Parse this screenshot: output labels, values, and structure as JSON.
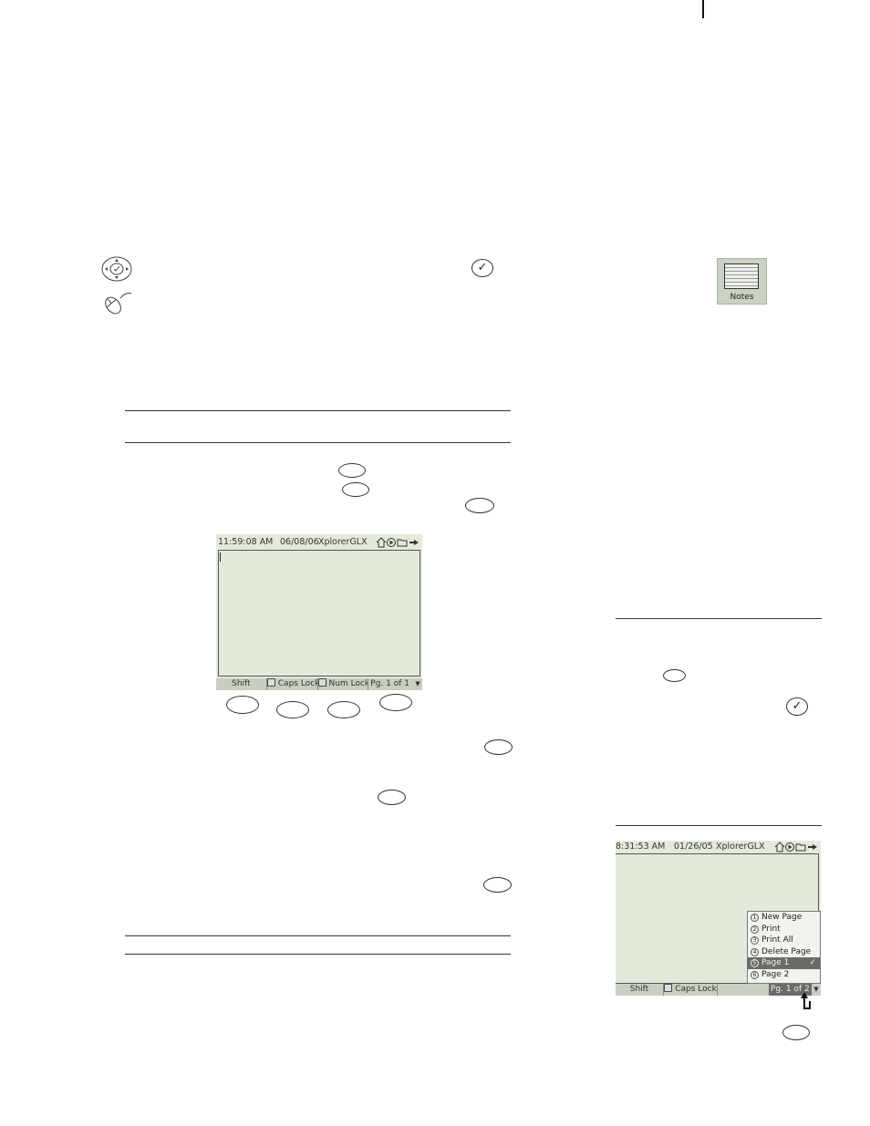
{
  "notes_icon": {
    "label": "Notes"
  },
  "check_symbol": "✓",
  "screen1": {
    "time": "11:59:08 AM",
    "date": "06/08/06",
    "app": "XplorerGLX",
    "bottom": [
      "Shift",
      "Caps Lock",
      "Num Lock",
      "Pg. 1 of 1"
    ]
  },
  "screen2": {
    "time": "8:31:53 AM",
    "date": "01/26/05",
    "app": "XplorerGLX",
    "bottom": [
      "Shift",
      "Caps Lock",
      "Pg. 1 of 2"
    ],
    "menu": [
      {
        "num": "1",
        "label": "New Page"
      },
      {
        "num": "2",
        "label": "Print"
      },
      {
        "num": "3",
        "label": "Print All"
      },
      {
        "num": "4",
        "label": "Delete Page"
      },
      {
        "num": "5",
        "label": "Page 1"
      },
      {
        "num": "6",
        "label": "Page 2"
      }
    ],
    "selected_tick": "✓"
  }
}
